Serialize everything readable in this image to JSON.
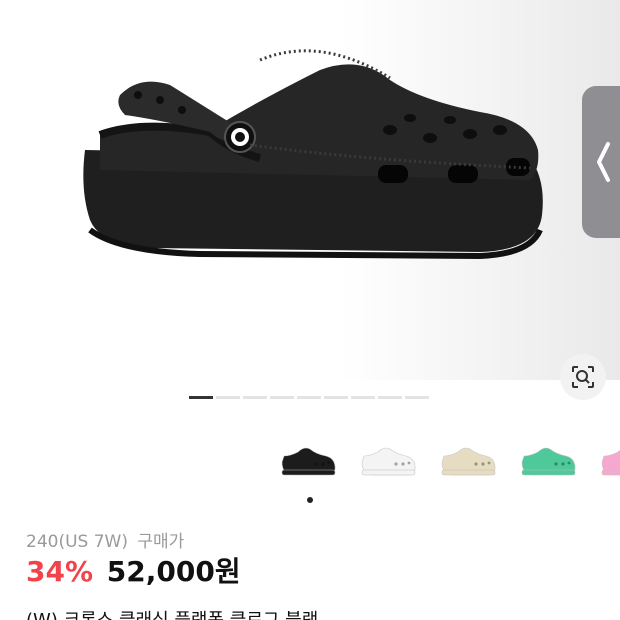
{
  "product": {
    "size_value": "240(US 7W)",
    "size_label": "구매가",
    "discount": "34%",
    "price": "52,000원",
    "title": "(W) 크록스 클래식 플랫폼 클로그 블랙"
  },
  "gallery": {
    "total_slides": 9,
    "active_slide": 1
  },
  "color_options": [
    {
      "name": "black-clog-thumbnail",
      "color": "#1c1c1c"
    },
    {
      "name": "white-clog-thumbnail",
      "color": "#f4f4f4"
    },
    {
      "name": "bone-clog-thumbnail",
      "color": "#e6dcc2"
    },
    {
      "name": "mint-clog-thumbnail",
      "color": "#4fc99a"
    },
    {
      "name": "pink-clog-thumbnail",
      "color": "#f6a9cf"
    }
  ],
  "colors": {
    "accent_red": "#f2434b",
    "text_dark": "#111111",
    "text_muted": "#9a9a9a",
    "side_tab": "#8e8e93"
  },
  "icons": {
    "back_arrow": "chevron-left-icon",
    "lens": "image-search-icon"
  }
}
